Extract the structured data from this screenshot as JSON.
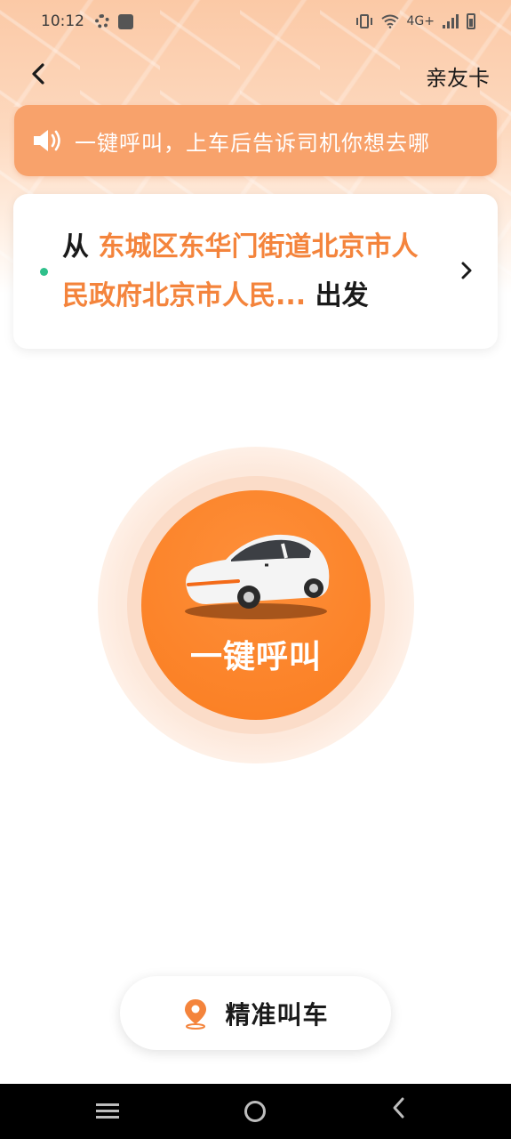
{
  "status_bar": {
    "time": "10:12",
    "network": "4G+",
    "icons": [
      "gear-icon",
      "shopping-bag-icon",
      "vibrate-icon",
      "wifi-icon",
      "signal-icon",
      "battery-icon"
    ]
  },
  "header": {
    "back_icon": "chevron-left-icon",
    "friend_card_label": "亲友卡"
  },
  "notice": {
    "icon": "speaker-icon",
    "text": "一键呼叫，上车后告诉司机你想去哪"
  },
  "start_card": {
    "prefix": "从",
    "address": "东城区东华门街道北京市人民政府北京市人民...",
    "suffix": "出发",
    "dot_color": "#2fc08b"
  },
  "call_button": {
    "label": "一键呼叫",
    "icon": "car-icon",
    "color": "#fa7d20"
  },
  "precise_button": {
    "label": "精准叫车",
    "icon": "location-pin-icon"
  },
  "nav_bar": {
    "icons": [
      "menu-icon",
      "home-icon",
      "back-icon"
    ]
  },
  "colors": {
    "accent": "#f4843c",
    "notice_bg": "#f8a26b"
  }
}
